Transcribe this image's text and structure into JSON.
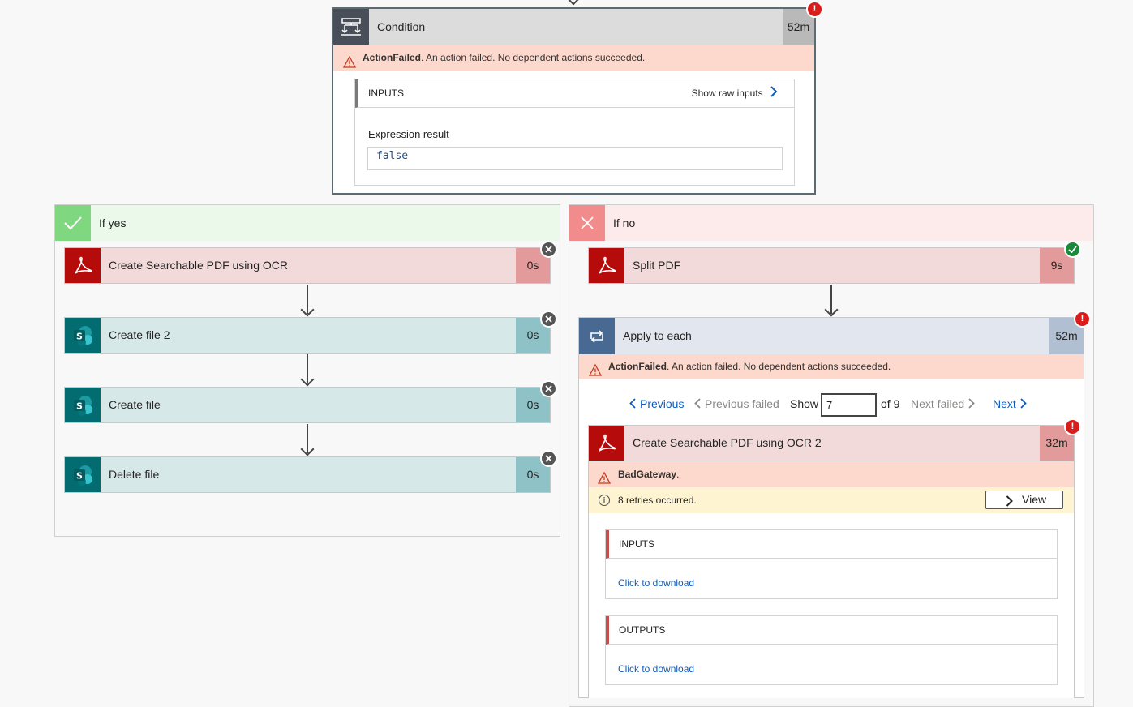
{
  "condition": {
    "title": "Condition",
    "duration": "52m",
    "badge": "!",
    "error": {
      "code": "ActionFailed",
      "message": ". An action failed. No dependent actions succeeded."
    },
    "inputs": {
      "header": "INPUTS",
      "show_raw": "Show raw inputs",
      "field_label": "Expression result",
      "field_value": "false"
    }
  },
  "if_yes": {
    "label": "If yes",
    "actions": [
      {
        "label": "Create Searchable PDF using OCR",
        "duration": "0s",
        "type": "pdf"
      },
      {
        "label": "Create file 2",
        "duration": "0s",
        "type": "sharepoint"
      },
      {
        "label": "Create file",
        "duration": "0s",
        "type": "sharepoint"
      },
      {
        "label": "Delete file",
        "duration": "0s",
        "type": "sharepoint"
      }
    ]
  },
  "if_no": {
    "label": "If no",
    "split_pdf": {
      "label": "Split PDF",
      "duration": "9s"
    },
    "apply_to_each": {
      "title": "Apply to each",
      "duration": "52m",
      "error": {
        "code": "ActionFailed",
        "message": ". An action failed. No dependent actions succeeded."
      },
      "pager": {
        "previous": "Previous",
        "previous_failed": "Previous failed",
        "show": "Show",
        "current": "7",
        "of": "of 9",
        "next_failed": "Next failed",
        "next": "Next"
      },
      "inner_action": {
        "label": "Create Searchable PDF using OCR 2",
        "duration": "32m",
        "error_code": "BadGateway",
        "error_suffix": ".",
        "retries": "8 retries occurred.",
        "view": "View",
        "inputs_header": "INPUTS",
        "inputs_link": "Click to download",
        "outputs_header": "OUTPUTS",
        "outputs_link": "Click to download"
      }
    }
  },
  "icons": {
    "condition": "condition-icon",
    "check": "checkmark-icon",
    "cross": "close-icon",
    "pdf": "adobe-acrobat-icon",
    "sharepoint": "sharepoint-icon",
    "loop": "loop-icon",
    "warning": "warning-icon",
    "info": "info-icon"
  },
  "colors": {
    "error_strip": "#fdd8cc",
    "yes_header": "#ebf9eb",
    "no_header": "#fdeaea",
    "pdf_red": "#b50b0b",
    "sharepoint_teal": "#036c70",
    "link_blue": "#0f5cbf"
  }
}
